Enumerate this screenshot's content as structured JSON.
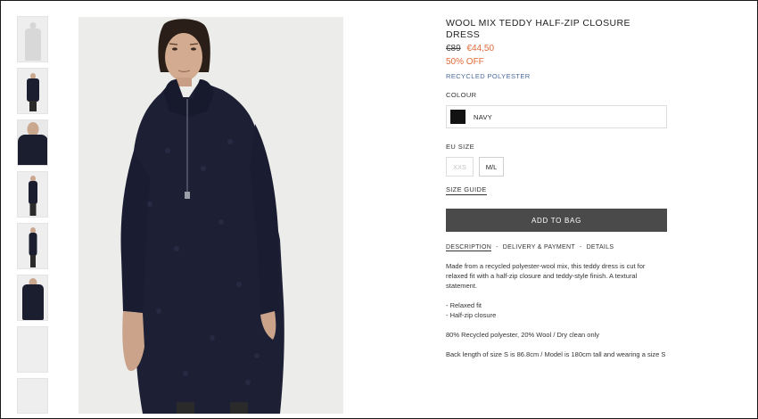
{
  "product": {
    "title": "WOOL MIX TEDDY HALF-ZIP CLOSURE DRESS",
    "price_old": "€89",
    "price_new": "€44,50",
    "discount": "50% OFF",
    "material": "RECYCLED POLYESTER"
  },
  "colour": {
    "label": "COLOUR",
    "selected": "NAVY",
    "swatch_color": "#121212"
  },
  "size": {
    "label": "EU SIZE",
    "options": [
      "XXS",
      "M/L"
    ],
    "guide_label": "SIZE GUIDE"
  },
  "actions": {
    "add_to_bag": "ADD TO BAG"
  },
  "tabs": [
    "DESCRIPTION",
    "DELIVERY & PAYMENT",
    "DETAILS"
  ],
  "tab_separator": "-",
  "description": {
    "intro": "Made from a recycled polyester-wool mix, this teddy dress is cut for relaxed fit with a half-zip closure and teddy-style finish. A textural statement.",
    "bullet_1": "- Relaxed fit",
    "bullet_2": "- Half-zip closure",
    "composition": "80% Recycled polyester, 20% Wool / Dry clean only",
    "fit_note": "Back length of size S is 86.8cm / Model is 180cm tall and wearing a size S"
  },
  "colors": {
    "accent_sale": "#e06a3a",
    "material_link": "#4a6a9a",
    "button_bg": "#4a4a4a",
    "garment_navy": "#1b1e2e"
  },
  "icons": {
    "thumbnails": [
      "product-thumbnail-front-white",
      "product-thumbnail-front-full",
      "product-thumbnail-collar-closeup",
      "product-thumbnail-side",
      "product-thumbnail-side-walking",
      "product-thumbnail-back",
      "product-thumbnail-blank",
      "product-thumbnail-blank"
    ]
  }
}
